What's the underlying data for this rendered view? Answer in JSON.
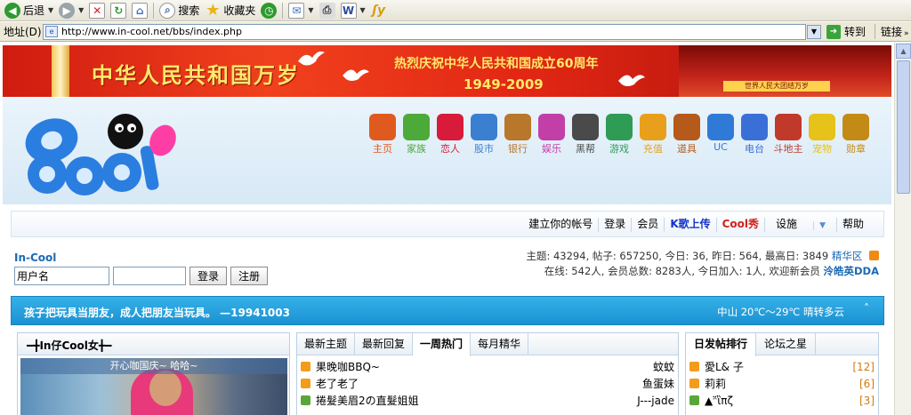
{
  "browser": {
    "toolbar": {
      "back_label": "后退",
      "search_label": "搜索",
      "favorites_label": "收藏夹"
    },
    "address": {
      "label": "地址(D)",
      "url": "http://www.in-cool.net/bbs/index.php",
      "go_label": "转到",
      "links_label": "链接"
    }
  },
  "banner": {
    "title": "中华人民共和国万岁",
    "subtitle": "热烈庆祝中华人民共和国成立60周年",
    "years": "1949-2009",
    "gate_plaque": "世界人民大团结万岁"
  },
  "nav_icons": [
    {
      "label": "主页",
      "color": "#e05a1f"
    },
    {
      "label": "家族",
      "color": "#4caa3a"
    },
    {
      "label": "恋人",
      "color": "#d81b3a"
    },
    {
      "label": "股市",
      "color": "#3b7fd0"
    },
    {
      "label": "银行",
      "color": "#b8772a"
    },
    {
      "label": "娱乐",
      "color": "#c23fa8"
    },
    {
      "label": "黑帮",
      "color": "#4a4a4a"
    },
    {
      "label": "游戏",
      "color": "#2e9c55"
    },
    {
      "label": "充值",
      "color": "#e8a01c"
    },
    {
      "label": "道具",
      "color": "#b55a1a"
    },
    {
      "label": "UC",
      "color": "#2f7ad6"
    },
    {
      "label": "电台",
      "color": "#3b6fd8"
    },
    {
      "label": "斗地主",
      "color": "#c0392b"
    },
    {
      "label": "宠物",
      "color": "#e6c21a"
    },
    {
      "label": "勋章",
      "color": "#c48a16"
    }
  ],
  "topnav": {
    "items": [
      "建立你的帐号",
      "登录",
      "会员",
      "K歌上传",
      "Cool秀",
      "设施",
      "帮助"
    ]
  },
  "site": {
    "name": "In-Cool"
  },
  "login": {
    "username_value": "用户名",
    "password_value": "",
    "login_button": "登录",
    "register_button": "注册"
  },
  "stats": {
    "line1": "主题: 43294, 帖子: 657250, 今日: 36, 昨日: 564, 最高日: 3849",
    "digest_link": "精华区",
    "line2": "在线: 542人, 会员总数: 8283人, 今日加入: 1人, 欢迎新会员",
    "new_member": "泠皓英DDA"
  },
  "notice": {
    "message": "孩子把玩具当朋友，成人把朋友当玩具。 —19941003",
    "weather": "中山  20℃～29℃ 晴转多云",
    "collapse_icon": "˄"
  },
  "panel_photo": {
    "title": "━╋In仔Cool女╋━",
    "caption": "开心咖国庆~  哈哈~"
  },
  "panel_threads": {
    "tabs": [
      "最新主题",
      "最新回复",
      "一周热门",
      "每月精华"
    ],
    "rows": [
      {
        "title": "果晚咖BBQ~",
        "author": "蚊蚊",
        "color": "#f39b1a"
      },
      {
        "title": "老了老了",
        "author": "鱼蛋妹",
        "color": "#f39b1a"
      },
      {
        "title": "捲髮美眉2の直髮姐姐",
        "author": "J---jade",
        "color": "#5aa63a"
      }
    ]
  },
  "panel_rank": {
    "tabs": [
      "日发帖排行",
      "论坛之星"
    ],
    "rows": [
      {
        "name": "愛L& 子",
        "count": "[12]",
        "color": "#f39b1a"
      },
      {
        "name": "莉莉",
        "count": "[6]",
        "color": "#f39b1a"
      },
      {
        "name": "▲ᵔ̈ἳπζ",
        "count": "[3]",
        "color": "#5aa63a"
      }
    ]
  }
}
